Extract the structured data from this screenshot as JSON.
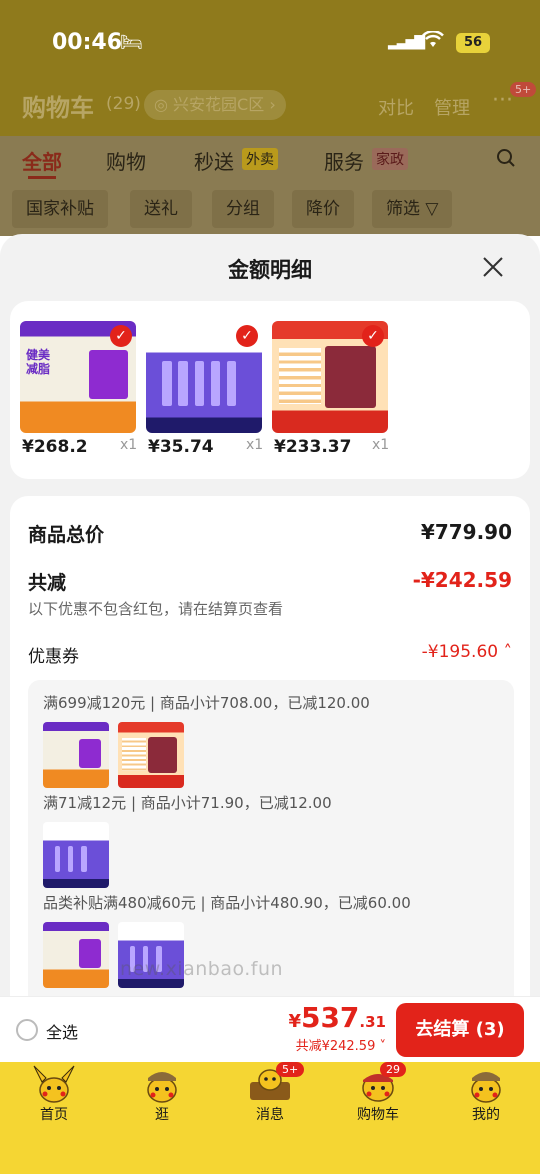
{
  "status_bar": {
    "time": "00:46",
    "battery": "56"
  },
  "cart_header": {
    "title": "购物车",
    "count": "(29)",
    "address": "兴安花园C区",
    "compare": "对比",
    "manage": "管理",
    "more_badge": "5+"
  },
  "tabs": [
    {
      "label": "全部"
    },
    {
      "label": "购物"
    },
    {
      "label": "秒送",
      "tag": "外卖"
    },
    {
      "label": "服务",
      "tag": "家政"
    }
  ],
  "filters": [
    "国家补贴",
    "送礼",
    "分组",
    "降价",
    "筛选"
  ],
  "sheet": {
    "title": "金额明细",
    "products": [
      {
        "price": "¥268.2",
        "qty": "x1"
      },
      {
        "price": "¥35.74",
        "qty": "x1"
      },
      {
        "price": "¥233.37",
        "qty": "x1"
      }
    ],
    "total_label": "商品总价",
    "total_value": "¥779.90",
    "discount_label": "共减",
    "discount_value": "-¥242.59",
    "discount_hint": "以下优惠不包含红包，请在结算页查看",
    "coupon_label": "优惠券",
    "coupon_value": "-¥195.60",
    "coupon_rules": [
      "满699减120元 | 商品小计708.00，已减120.00",
      "满71减12元 | 商品小计71.90，已减12.00",
      "品类补贴满480减60元 | 商品小计480.90，已减60.00"
    ]
  },
  "watermark": "new.xianbao.fun",
  "checkout": {
    "select_all": "全选",
    "total_symbol": "¥",
    "total_int": "537",
    "total_dec": ".31",
    "saved": "共减¥242.59",
    "pay_button": "去结算 (3)"
  },
  "bottom_nav": {
    "items": [
      {
        "label": "首页"
      },
      {
        "label": "逛"
      },
      {
        "label": "消息",
        "badge": "5+"
      },
      {
        "label": "购物车",
        "badge": "29"
      },
      {
        "label": "我的"
      }
    ]
  },
  "colors": {
    "accent": "#e2231a",
    "nav_bg": "#f5d633",
    "sheet_bg": "#f2f2f2"
  }
}
